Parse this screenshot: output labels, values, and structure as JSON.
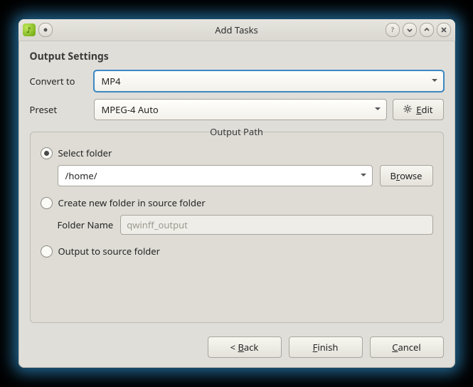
{
  "window": {
    "title": "Add Tasks"
  },
  "section": {
    "heading": "Output Settings",
    "convert_label": "Convert to",
    "convert_value": "MP4",
    "preset_label": "Preset",
    "preset_value": "MPEG-4 Auto",
    "edit_label": "Edit"
  },
  "outpath": {
    "legend": "Output Path",
    "opt_select": "Select folder",
    "path_value": "/home/",
    "browse_label": "Browse",
    "opt_create": "Create new folder in source folder",
    "folder_name_label": "Folder Name",
    "folder_name_placeholder": "qwinff_output",
    "opt_source": "Output to source folder"
  },
  "footer": {
    "back": "< Back",
    "finish": "Finish",
    "cancel": "Cancel"
  }
}
